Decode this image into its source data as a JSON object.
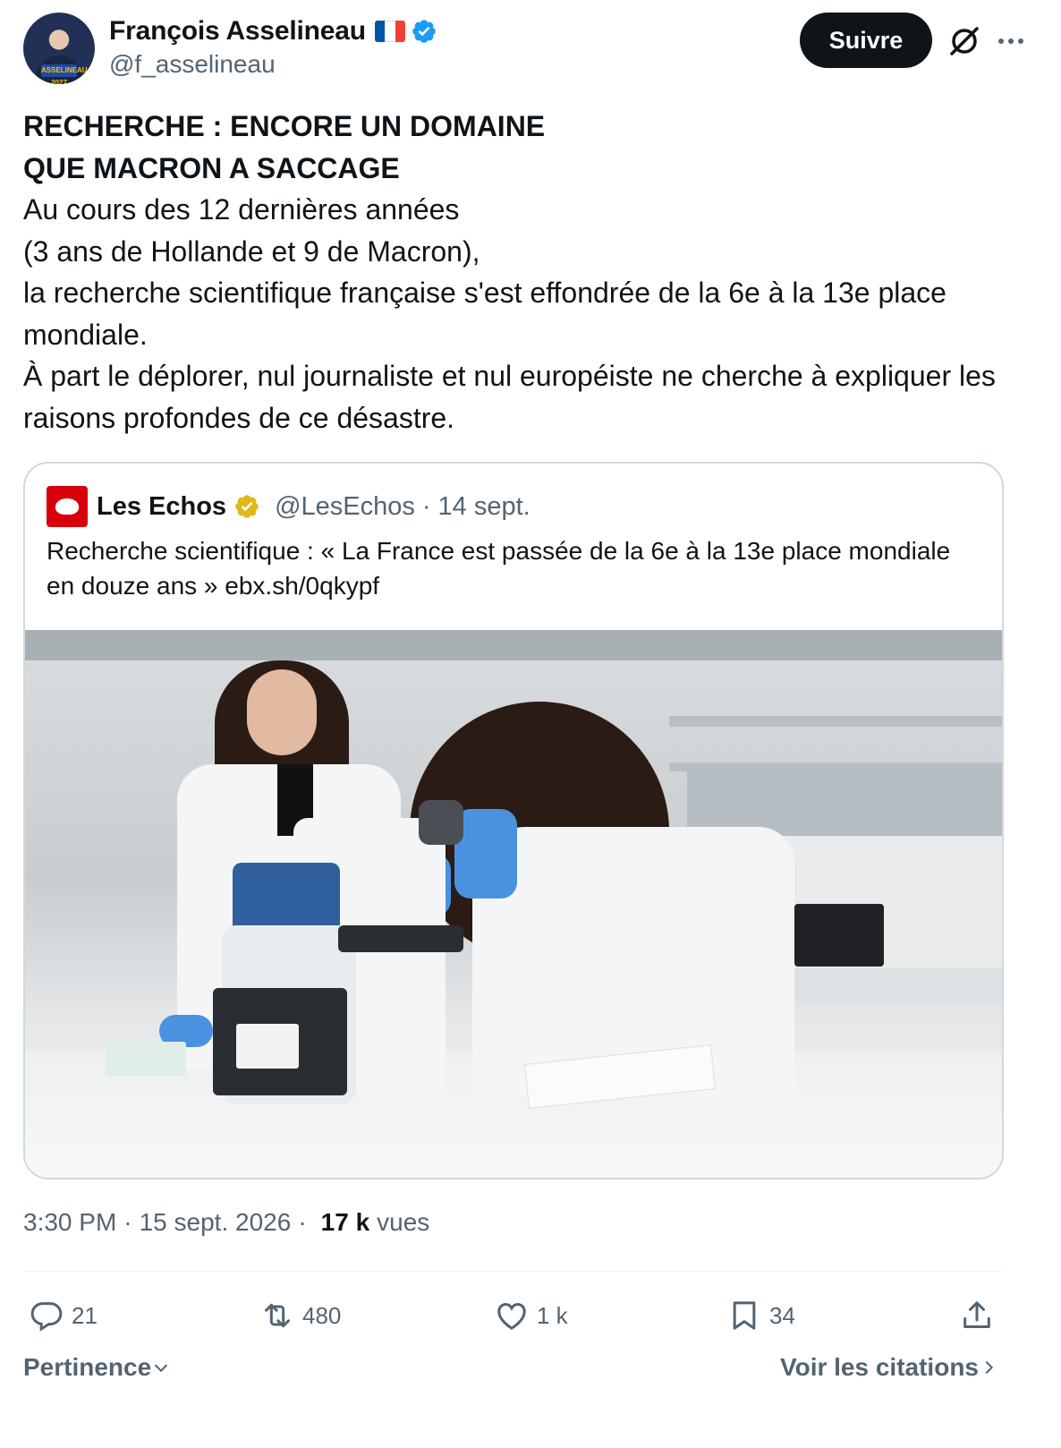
{
  "author": {
    "name": "François Asselineau",
    "handle": "@f_asselineau",
    "avatar_badge": "ASSELINEAU 2027",
    "flag_colors": [
      "#0055a4",
      "#ffffff",
      "#ef4135"
    ],
    "verified_color": "#1d9bf0"
  },
  "header": {
    "follow_label": "Suivre",
    "grok_icon": "slashed-circle-icon",
    "more_icon": "more-dots-icon"
  },
  "tweet": {
    "headline_1": "RECHERCHE : ENCORE UN DOMAINE",
    "headline_2": "QUE MACRON A SACCAGE",
    "lines": [
      "Au cours des 12 dernières années",
      "(3 ans de Hollande et 9 de Macron),",
      "la recherche scientifique française s'est effondrée de la 6e à la 13e place mondiale.",
      "À part le déplorer, nul journaliste et nul européiste ne cherche à expliquer les raisons profondes de ce désastre."
    ]
  },
  "quote": {
    "name": "Les Echos",
    "handle": "@LesEchos",
    "separator": "·",
    "date": "14 sept.",
    "text": "Recherche scientifique : « La France est passée de la 6e à la 13e place mondiale en douze ans » ebx.sh/0qkypf",
    "badge_color": "#e2b719",
    "logo_color": "#d8000b"
  },
  "meta": {
    "time": "3:30 PM",
    "date": "15 sept. 2026",
    "separator": "·",
    "views_count": "17 k",
    "views_label": "vues"
  },
  "actions": {
    "replies": "21",
    "reposts": "480",
    "likes": "1 k",
    "bookmarks": "34"
  },
  "footer": {
    "sort_label": "Pertinence",
    "quotes_label": "Voir les citations"
  }
}
